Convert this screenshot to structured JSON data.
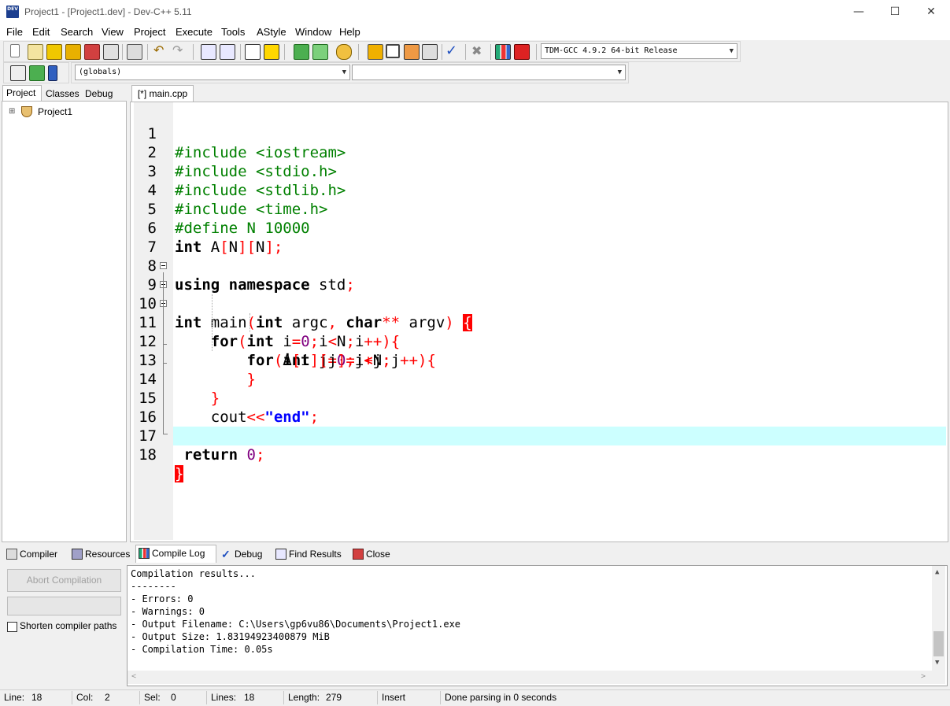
{
  "window": {
    "title": "Project1 - [Project1.dev] - Dev-C++ 5.11",
    "app_icon_text": "DEV",
    "minimize": "—",
    "maximize": "☐",
    "close": "✕"
  },
  "menu": [
    "File",
    "Edit",
    "Search",
    "View",
    "Project",
    "Execute",
    "Tools",
    "AStyle",
    "Window",
    "Help"
  ],
  "toolbar": {
    "compiler_select": "TDM-GCC 4.9.2 64-bit Release",
    "scope_select": "(globals)",
    "member_select": ""
  },
  "left_tabs": [
    "Project",
    "Classes",
    "Debug"
  ],
  "project_tree": {
    "expander": "⊞",
    "root": "Project1"
  },
  "editor": {
    "tab_label": "[*] main.cpp",
    "line_numbers": [
      "1",
      "2",
      "3",
      "4",
      "5",
      "6",
      "7",
      "8",
      "9",
      "10",
      "11",
      "12",
      "13",
      "14",
      "15",
      "16",
      "17",
      "18"
    ]
  },
  "bottom_tabs": [
    "Compiler",
    "Resources",
    "Compile Log",
    "Debug",
    "Find Results",
    "Close"
  ],
  "compile_panel": {
    "abort_button": "Abort Compilation",
    "shorten_paths_label": "Shorten compiler paths",
    "log_lines": [
      "Compilation results...",
      "--------",
      "- Errors: 0",
      "- Warnings: 0",
      "- Output Filename: C:\\Users\\gp6vu86\\Documents\\Project1.exe",
      "- Output Size: 1.83194923400879 MiB",
      "- Compilation Time: 0.05s"
    ]
  },
  "status": {
    "line_label": "Line:",
    "line_value": "18",
    "col_label": "Col:",
    "col_value": "2",
    "sel_label": "Sel:",
    "sel_value": "0",
    "lines_label": "Lines:",
    "lines_value": "18",
    "length_label": "Length:",
    "length_value": "279",
    "mode": "Insert",
    "message": "Done parsing in 0 seconds"
  },
  "colors": {
    "preprocessor": "#008000",
    "symbol": "#ff0000",
    "number": "#800080",
    "string": "#0000ff",
    "active_line": "#ccffff",
    "brace_match": "#ff0000"
  }
}
